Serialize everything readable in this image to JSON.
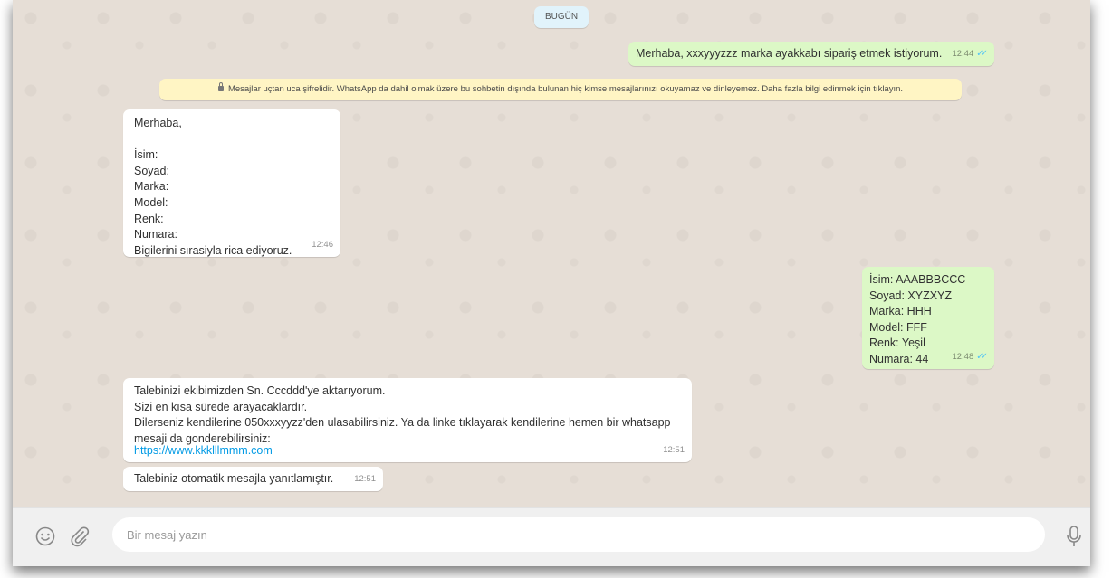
{
  "chat": {
    "date_chip": "BUGÜN",
    "encryption_notice": "Mesajlar uçtan uca şifrelidir. WhatsApp da dahil olmak üzere bu sohbetin dışında bulunan hiç kimse mesajlarınızı okuyamaz ve dinleyemez. Daha fazla bilgi edinmek için tıklayın.",
    "messages": [
      {
        "direction": "outgoing",
        "text": "Merhaba, xxxyyyzzz marka ayakkabı sipariş etmek istiyorum.",
        "time": "12:44",
        "status": "read"
      },
      {
        "direction": "incoming",
        "text": "Merhaba,\n\nİsim:\nSoyad:\nMarka:\nModel:\nRenk:\nNumara:\nBigilerini  sırasiyla rica ediyoruz.",
        "time": "12:46"
      },
      {
        "direction": "outgoing",
        "text": "İsim: AAABBBCCC\nSoyad: XYZXYZ\nMarka: HHH\nModel: FFF\nRenk: Yeşil\nNumara: 44",
        "time": "12:48",
        "status": "read"
      },
      {
        "direction": "incoming",
        "text": "Talebinizi ekibimizden Sn. Cccddd'ye aktarıyorum.\nSizi en kısa sürede arayacaklardır.\nDilerseniz kendilerine 050xxxyyzz'den ulasabilirsiniz. Ya da linke tıklayarak kendilerine hemen bir whatsapp\nmesaji da gonderebilirsiniz:",
        "link": "https://www.kkklllmmm.com",
        "time": "12:51"
      },
      {
        "direction": "incoming",
        "text": "Talebiniz otomatik mesajla yanıtlamıştır.",
        "time": "12:51"
      }
    ]
  },
  "composer": {
    "placeholder": "Bir mesaj yazın",
    "emoji_icon": "emoji-icon",
    "attach_icon": "paperclip-icon",
    "mic_icon": "microphone-icon"
  },
  "colors": {
    "chat_background": "#e6ded6",
    "incoming_bubble": "#ffffff",
    "outgoing_bubble": "#dcf8c6",
    "date_chip": "#e1f3fb",
    "notice": "#fff5c4",
    "read_ticks": "#4fc3f7",
    "link": "#039be5"
  }
}
